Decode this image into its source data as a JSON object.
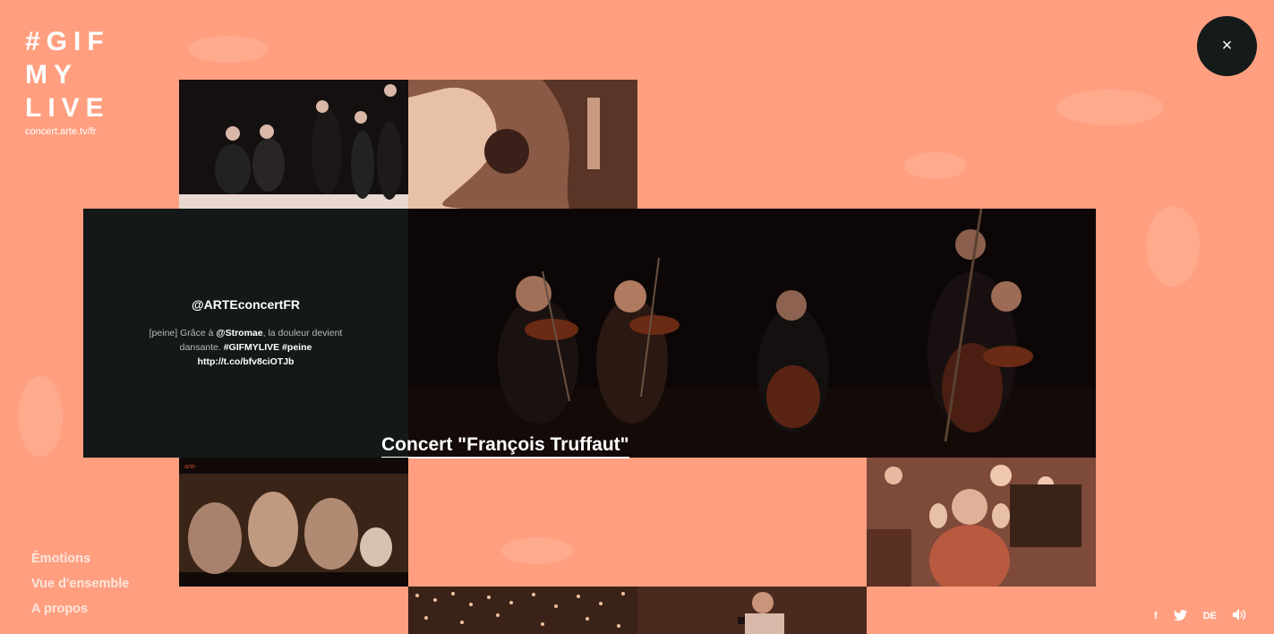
{
  "logo": {
    "lines": [
      "#GIF",
      "MY",
      "LIVE"
    ],
    "url": "concert.arte.tv/fr"
  },
  "close_label": "×",
  "tweet": {
    "handle": "@ARTEconcertFR",
    "text_prefix": "[peine] Grâce à ",
    "mention": "@Stromae",
    "text_mid": ", la douleur devient dansante. ",
    "hashtags": "#GIFMYLIVE #peine",
    "link": "http://t.co/bfv8ciOTJb"
  },
  "caption": "Concert \"François Truffaut\"",
  "nav": [
    "Émotions",
    "Vue d'ensemble",
    "A propos"
  ],
  "footer": {
    "facebook": "f",
    "twitter": "twitter-icon",
    "lang": "DE",
    "sound": "sound-icon"
  },
  "colors": {
    "background": "#ff9f80",
    "dark": "#141818"
  }
}
